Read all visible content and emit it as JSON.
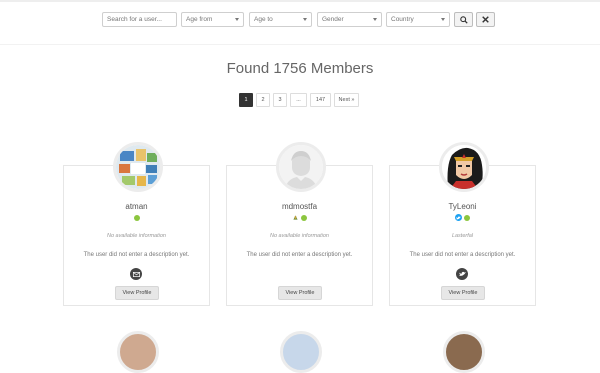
{
  "filters": {
    "search_placeholder": "Search for a user...",
    "age_from": "Age from",
    "age_to": "Age to",
    "gender": "Gender",
    "country": "Country",
    "search_icon": "search-icon",
    "clear_icon": "close-icon"
  },
  "results": {
    "title": "Found 1756 Members"
  },
  "pagination": {
    "pages": [
      "1",
      "2",
      "3",
      "...",
      "147"
    ],
    "next": "Next »",
    "active": "1"
  },
  "members": [
    {
      "name": "atman",
      "info": "No available information",
      "description": "The user did not enter a description yet.",
      "button": "View Profile",
      "social_icon": "email-icon",
      "status_color": "#8cc63f"
    },
    {
      "name": "mdmostfa",
      "info": "No available information",
      "description": "The user did not enter a description yet.",
      "button": "View Profile",
      "social_icon": "",
      "status_color": "#8cc63f"
    },
    {
      "name": "TyLeoni",
      "info": "Lasterfal",
      "description": "The user did not enter a description yet.",
      "button": "View Profile",
      "social_icon": "twitter-icon",
      "status_color": "#8cc63f"
    }
  ],
  "colors": {
    "accent_dark": "#333333",
    "online": "#8cc63f",
    "twitter": "#1da1f2"
  }
}
